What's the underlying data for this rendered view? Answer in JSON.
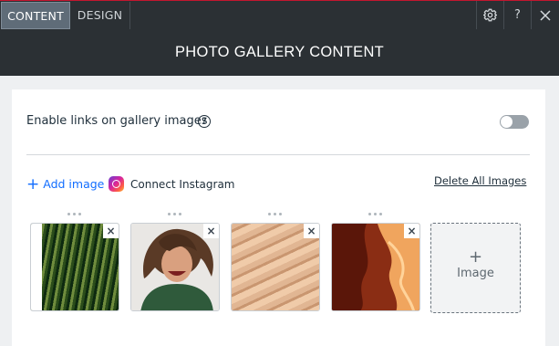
{
  "tabs": {
    "content": "CONTENT",
    "design": "DESIGN"
  },
  "toolbar": {
    "help": "?"
  },
  "title": "PHOTO GALLERY CONTENT",
  "settings": {
    "links_label": "Enable links on gallery images",
    "help_glyph": "?",
    "links_enabled": false
  },
  "actions": {
    "add_image": "Add image",
    "add_plus": "+",
    "connect_instagram": "Connect Instagram",
    "delete_all": "Delete All Images"
  },
  "gallery": {
    "remove_glyph": "×",
    "add_tile_plus": "+",
    "add_tile_label": "Image"
  },
  "colors": {
    "accent": "#116dff",
    "topbar": "#2b3034",
    "active_tab": "#5f6c78"
  }
}
